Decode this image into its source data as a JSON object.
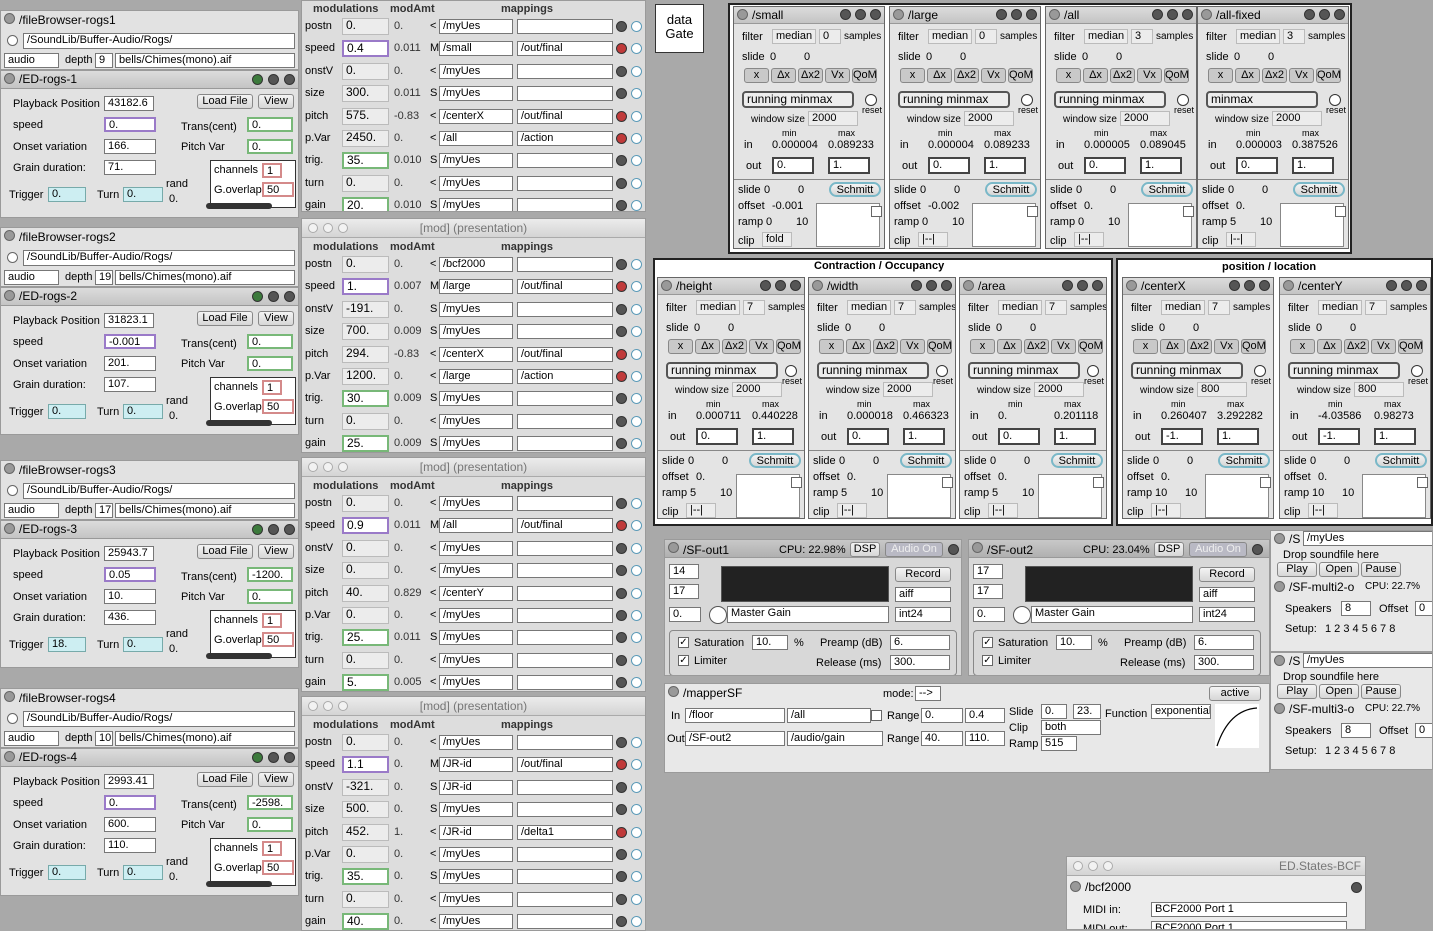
{
  "filebrowsers": [
    {
      "title": "/fileBrowser-rogs1",
      "path": "/SoundLib/Buffer-Audio/Rogs/",
      "type": "audio",
      "depth_label": "depth",
      "depth": "9",
      "file": "bells/Chimes(mono).aif",
      "ed": "/ED-rogs-1",
      "playback": "43182.6",
      "speed": "0.",
      "onset": "166.",
      "grain": "71.",
      "trans": "0.",
      "pitchvar": "0.",
      "channels": "1",
      "goverlap": "50",
      "trigger": "0.",
      "turn": "0.",
      "rand": "0."
    },
    {
      "title": "/fileBrowser-rogs2",
      "path": "/SoundLib/Buffer-Audio/Rogs/",
      "type": "audio",
      "depth_label": "depth",
      "depth": "19",
      "file": "bells/Chimes(mono).aif",
      "ed": "/ED-rogs-2",
      "playback": "31823.1",
      "speed": "-0.001",
      "onset": "201.",
      "grain": "107.",
      "trans": "0.",
      "pitchvar": "0.",
      "channels": "1",
      "goverlap": "50",
      "trigger": "0.",
      "turn": "0.",
      "rand": "0."
    },
    {
      "title": "/fileBrowser-rogs3",
      "path": "/SoundLib/Buffer-Audio/Rogs/",
      "type": "audio",
      "depth_label": "depth",
      "depth": "17",
      "file": "bells/Chimes(mono).aif",
      "ed": "/ED-rogs-3",
      "playback": "25943.7",
      "speed": "0.05",
      "onset": "10.",
      "grain": "436.",
      "trans": "-1200.",
      "pitchvar": "0.",
      "channels": "1",
      "goverlap": "50",
      "trigger": "18.",
      "turn": "0.",
      "rand": "0."
    },
    {
      "title": "/fileBrowser-rogs4",
      "path": "/SoundLib/Buffer-Audio/Rogs/",
      "type": "audio",
      "depth_label": "depth",
      "depth": "10",
      "file": "bells/Chimes(mono).aif",
      "ed": "/ED-rogs-4",
      "playback": "2993.41",
      "speed": "0.",
      "onset": "600.",
      "grain": "110.",
      "trans": "-2598.",
      "pitchvar": "0.",
      "channels": "1",
      "goverlap": "50",
      "trigger": "0.",
      "turn": "0.",
      "rand": "0."
    }
  ],
  "ed_labels": {
    "playback": "Playback Position",
    "speed": "speed",
    "onset": "Onset variation",
    "grain": "Grain duration:",
    "trans": "Trans(cent)",
    "pitchvar": "Pitch Var",
    "channels": "channels",
    "goverlap": "G.overlap",
    "trigger": "Trigger",
    "turn": "Turn",
    "rand": "rand",
    "load": "Load File",
    "view": "View"
  },
  "mod_headers": {
    "modulations": "modulations",
    "modamt": "modAmt",
    "mappings": "mappings",
    "window": "[mod] (presentation)"
  },
  "mod_panels": [
    {
      "rows": [
        {
          "n": "postn",
          "v": "0.",
          "a": "0.",
          "f": "<",
          "m": "/myUes",
          "t": ""
        },
        {
          "n": "speed",
          "v": "0.4",
          "a": "0.011",
          "f": "M",
          "m": "/small",
          "t": "/out/final"
        },
        {
          "n": "onstV",
          "v": "0.",
          "a": "0.",
          "f": "<",
          "m": "/myUes",
          "t": ""
        },
        {
          "n": "size",
          "v": "300.",
          "a": "0.011",
          "f": "S",
          "m": "/myUes",
          "t": ""
        },
        {
          "n": "pitch",
          "v": "575.",
          "a": "-0.83",
          "f": "<",
          "m": "/centerX",
          "t": "/out/final"
        },
        {
          "n": "p.Var",
          "v": "2450.",
          "a": "0.",
          "f": "<",
          "m": "/all",
          "t": "/action"
        },
        {
          "n": "trig.",
          "v": "35.",
          "a": "0.010",
          "f": "S",
          "m": "/myUes",
          "t": ""
        },
        {
          "n": "turn",
          "v": "0.",
          "a": "0.",
          "f": "<",
          "m": "/myUes",
          "t": ""
        },
        {
          "n": "gain",
          "v": "20.",
          "a": "0.010",
          "f": "S",
          "m": "/myUes",
          "t": ""
        }
      ]
    },
    {
      "rows": [
        {
          "n": "postn",
          "v": "0.",
          "a": "0.",
          "f": "<",
          "m": "/bcf2000",
          "t": ""
        },
        {
          "n": "speed",
          "v": "1.",
          "a": "0.007",
          "f": "M",
          "m": "/large",
          "t": "/out/final"
        },
        {
          "n": "onstV",
          "v": "-191.",
          "a": "0.",
          "f": "S",
          "m": "/myUes",
          "t": ""
        },
        {
          "n": "size",
          "v": "700.",
          "a": "0.009",
          "f": "S",
          "m": "/myUes",
          "t": ""
        },
        {
          "n": "pitch",
          "v": "294.",
          "a": "-0.83",
          "f": "<",
          "m": "/centerX",
          "t": "/out/final"
        },
        {
          "n": "p.Var",
          "v": "1200.",
          "a": "0.",
          "f": "<",
          "m": "/large",
          "t": "/action"
        },
        {
          "n": "trig.",
          "v": "30.",
          "a": "0.009",
          "f": "S",
          "m": "/myUes",
          "t": ""
        },
        {
          "n": "turn",
          "v": "0.",
          "a": "0.",
          "f": "<",
          "m": "/myUes",
          "t": ""
        },
        {
          "n": "gain",
          "v": "25.",
          "a": "0.009",
          "f": "S",
          "m": "/myUes",
          "t": ""
        }
      ]
    },
    {
      "rows": [
        {
          "n": "postn",
          "v": "0.",
          "a": "0.",
          "f": "<",
          "m": "/myUes",
          "t": ""
        },
        {
          "n": "speed",
          "v": "0.9",
          "a": "0.011",
          "f": "M",
          "m": "/all",
          "t": "/out/final"
        },
        {
          "n": "onstV",
          "v": "0.",
          "a": "0.",
          "f": "<",
          "m": "/myUes",
          "t": ""
        },
        {
          "n": "size",
          "v": "0.",
          "a": "0.",
          "f": "<",
          "m": "/myUes",
          "t": ""
        },
        {
          "n": "pitch",
          "v": "40.",
          "a": "0.829",
          "f": "<",
          "m": "/centerY",
          "t": ""
        },
        {
          "n": "p.Var",
          "v": "0.",
          "a": "0.",
          "f": "<",
          "m": "/myUes",
          "t": ""
        },
        {
          "n": "trig.",
          "v": "25.",
          "a": "0.011",
          "f": "S",
          "m": "/myUes",
          "t": ""
        },
        {
          "n": "turn",
          "v": "0.",
          "a": "0.",
          "f": "<",
          "m": "/myUes",
          "t": ""
        },
        {
          "n": "gain",
          "v": "5.",
          "a": "0.005",
          "f": "<",
          "m": "/myUes",
          "t": ""
        }
      ]
    },
    {
      "rows": [
        {
          "n": "postn",
          "v": "0.",
          "a": "0.",
          "f": "<",
          "m": "/myUes",
          "t": ""
        },
        {
          "n": "speed",
          "v": "1.1",
          "a": "0.",
          "f": "M",
          "m": "/JR-id",
          "t": "/out/final"
        },
        {
          "n": "onstV",
          "v": "-321.",
          "a": "0.",
          "f": "S",
          "m": "/JR-id",
          "t": ""
        },
        {
          "n": "size",
          "v": "500.",
          "a": "0.",
          "f": "S",
          "m": "/myUes",
          "t": ""
        },
        {
          "n": "pitch",
          "v": "452.",
          "a": "1.",
          "f": "<",
          "m": "/JR-id",
          "t": "/delta1"
        },
        {
          "n": "p.Var",
          "v": "0.",
          "a": "0.",
          "f": "<",
          "m": "/myUes",
          "t": ""
        },
        {
          "n": "trig.",
          "v": "35.",
          "a": "0.",
          "f": "S",
          "m": "/myUes",
          "t": ""
        },
        {
          "n": "turn",
          "v": "0.",
          "a": "0.",
          "f": "<",
          "m": "/myUes",
          "t": ""
        },
        {
          "n": "gain",
          "v": "40.",
          "a": "0.",
          "f": "<",
          "m": "/myUes",
          "t": ""
        }
      ]
    }
  ],
  "datagate": "data Gate",
  "groups": {
    "contraction": "Contraction / Occupancy",
    "position": "position / location"
  },
  "fl_labels": {
    "filter": "filter",
    "slide": "slide",
    "samples": "samples",
    "reset": "reset",
    "window": "window size",
    "min": "min",
    "max": "max",
    "in": "in",
    "out": "out",
    "offset": "offset",
    "ramp": "ramp",
    "clip": "clip",
    "schmitt": "Schmitt",
    "b1": "x",
    "b2": "Δx",
    "b3": "Δx2",
    "b4": "Vx",
    "b5": "QoM"
  },
  "filters": [
    {
      "title": "/small",
      "filter": "median",
      "samples": "0",
      "slide1": "0",
      "slide2": "0",
      "mode": "running minmax",
      "window": "2000",
      "min": "0.000004",
      "max": "0.089233",
      "out1": "0.",
      "out2": "1.",
      "s1": "0",
      "s2": "0",
      "offset": "-0.001",
      "ramp1": "0",
      "ramp2": "10",
      "clip": "fold"
    },
    {
      "title": "/large",
      "filter": "median",
      "samples": "0",
      "slide1": "0",
      "slide2": "0",
      "mode": "running minmax",
      "window": "2000",
      "min": "0.000004",
      "max": "0.089233",
      "out1": "0.",
      "out2": "1.",
      "s1": "0",
      "s2": "0",
      "offset": "-0.002",
      "ramp1": "0",
      "ramp2": "10",
      "clip": "|--|"
    },
    {
      "title": "/all",
      "filter": "median",
      "samples": "3",
      "slide1": "0",
      "slide2": "0",
      "mode": "running minmax",
      "window": "2000",
      "min": "0.000005",
      "max": "0.089045",
      "out1": "0.",
      "out2": "1.",
      "s1": "0",
      "s2": "0",
      "offset": "0.",
      "ramp1": "0",
      "ramp2": "10",
      "clip": "|--|"
    },
    {
      "title": "/all-fixed",
      "filter": "median",
      "samples": "3",
      "slide1": "0",
      "slide2": "0",
      "mode": "minmax",
      "window": "2000",
      "min": "0.000003",
      "max": "0.387526",
      "out1": "0.",
      "out2": "1.",
      "s1": "0",
      "s2": "0",
      "offset": "0.",
      "ramp1": "5",
      "ramp2": "10",
      "clip": "|--|"
    },
    {
      "title": "/height",
      "filter": "median",
      "samples": "7",
      "slide1": "0",
      "slide2": "0",
      "mode": "running minmax",
      "window": "2000",
      "min": "0.000711",
      "max": "0.440228",
      "out1": "0.",
      "out2": "1.",
      "s1": "0",
      "s2": "0",
      "offset": "0.",
      "ramp1": "5",
      "ramp2": "10",
      "clip": "|--|"
    },
    {
      "title": "/width",
      "filter": "median",
      "samples": "7",
      "slide1": "0",
      "slide2": "0",
      "mode": "running minmax",
      "window": "2000",
      "min": "0.000018",
      "max": "0.466323",
      "out1": "0.",
      "out2": "1.",
      "s1": "0",
      "s2": "0",
      "offset": "0.",
      "ramp1": "5",
      "ramp2": "10",
      "clip": "|--|"
    },
    {
      "title": "/area",
      "filter": "median",
      "samples": "7",
      "slide1": "0",
      "slide2": "0",
      "mode": "running minmax",
      "window": "2000",
      "min": "0.",
      "max": "0.201118",
      "out1": "0.",
      "out2": "1.",
      "s1": "0",
      "s2": "0",
      "offset": "0.",
      "ramp1": "5",
      "ramp2": "10",
      "clip": "|--|"
    },
    {
      "title": "/centerX",
      "filter": "median",
      "samples": "7",
      "slide1": "0",
      "slide2": "0",
      "mode": "running minmax",
      "window": "800",
      "min": "0.260407",
      "max": "3.292282",
      "out1": "-1.",
      "out2": "1.",
      "s1": "0",
      "s2": "0",
      "offset": "0.",
      "ramp1": "10",
      "ramp2": "10",
      "clip": "|--|"
    },
    {
      "title": "/centerY",
      "filter": "median",
      "samples": "7",
      "slide1": "0",
      "slide2": "0",
      "mode": "running minmax",
      "window": "800",
      "min": "-4.03586",
      "max": "0.98273",
      "out1": "-1.",
      "out2": "1.",
      "s1": "0",
      "s2": "0",
      "offset": "0.",
      "ramp1": "10",
      "ramp2": "10",
      "clip": "|--|"
    }
  ],
  "sfouts": [
    {
      "title": "/SF-out1",
      "cpu": "CPU: 22.98%",
      "dsp": "DSP",
      "audioon": "Audio On",
      "n1": "14",
      "n2": "17",
      "gainval": "0.",
      "gainlabel": "Master Gain",
      "record": "Record",
      "fmt": "aiff",
      "bits": "int24",
      "sat": "Saturation",
      "satv": "10.",
      "pct": "%",
      "lim": "Limiter",
      "preamp": "Preamp (dB)",
      "preampv": "6.",
      "release": "Release (ms)",
      "releasev": "300."
    },
    {
      "title": "/SF-out2",
      "cpu": "CPU: 23.04%",
      "dsp": "DSP",
      "audioon": "Audio On",
      "n1": "17",
      "n2": "17",
      "gainval": "0.",
      "gainlabel": "Master Gain",
      "record": "Record",
      "fmt": "aiff",
      "bits": "int24",
      "sat": "Saturation",
      "satv": "10.",
      "pct": "%",
      "lim": "Limiter",
      "preamp": "Preamp (dB)",
      "preampv": "6.",
      "release": "Release (ms)",
      "releasev": "300."
    }
  ],
  "mapper": {
    "title": "/mapperSF",
    "mode_label": "mode:",
    "mode": "-->",
    "active": "active",
    "in_label": "In",
    "in1": "/floor",
    "in2": "/all",
    "range_label": "Range",
    "rin1": "0.",
    "rin2": "0.4",
    "out_label": "Out",
    "out1": "/SF-out2",
    "out2": "/audio/gain",
    "rout1": "40.",
    "rout2": "110.",
    "slide_label": "Slide",
    "slide1": "0.",
    "slide2": "23.",
    "clip_label": "Clip",
    "clip": "both",
    "ramp_label": "Ramp",
    "ramp": "515",
    "func_label": "Function",
    "func": "exponential"
  },
  "multi": [
    {
      "s": "/S",
      "ues": "/myUes",
      "drop": "Drop soundfile here",
      "play": "Play",
      "open": "Open",
      "pause": "Pause",
      "title": "/SF-multi2-o",
      "cpu": "CPU: 22.7%",
      "speakers": "Speakers",
      "spk": "8",
      "offset": "Offset",
      "off": "0",
      "setup": "Setup:",
      "nums": "1 2 3 4 5 6 7 8"
    },
    {
      "s": "/S",
      "ues": "/myUes",
      "drop": "Drop soundfile here",
      "play": "Play",
      "open": "Open",
      "pause": "Pause",
      "title": "/SF-multi3-o",
      "cpu": "CPU: 22.7%",
      "speakers": "Speakers",
      "spk": "8",
      "offset": "Offset",
      "off": "0",
      "setup": "Setup:",
      "nums": "1 2 3 4 5 6 7 8"
    }
  ],
  "states": {
    "window": "ED.States-BCF",
    "title": "/bcf2000",
    "midiin_label": "MIDI in:",
    "midiin": "BCF2000 Port 1",
    "midiout_label": "MIDI out:",
    "midiout": "BCF2000 Port 1"
  }
}
